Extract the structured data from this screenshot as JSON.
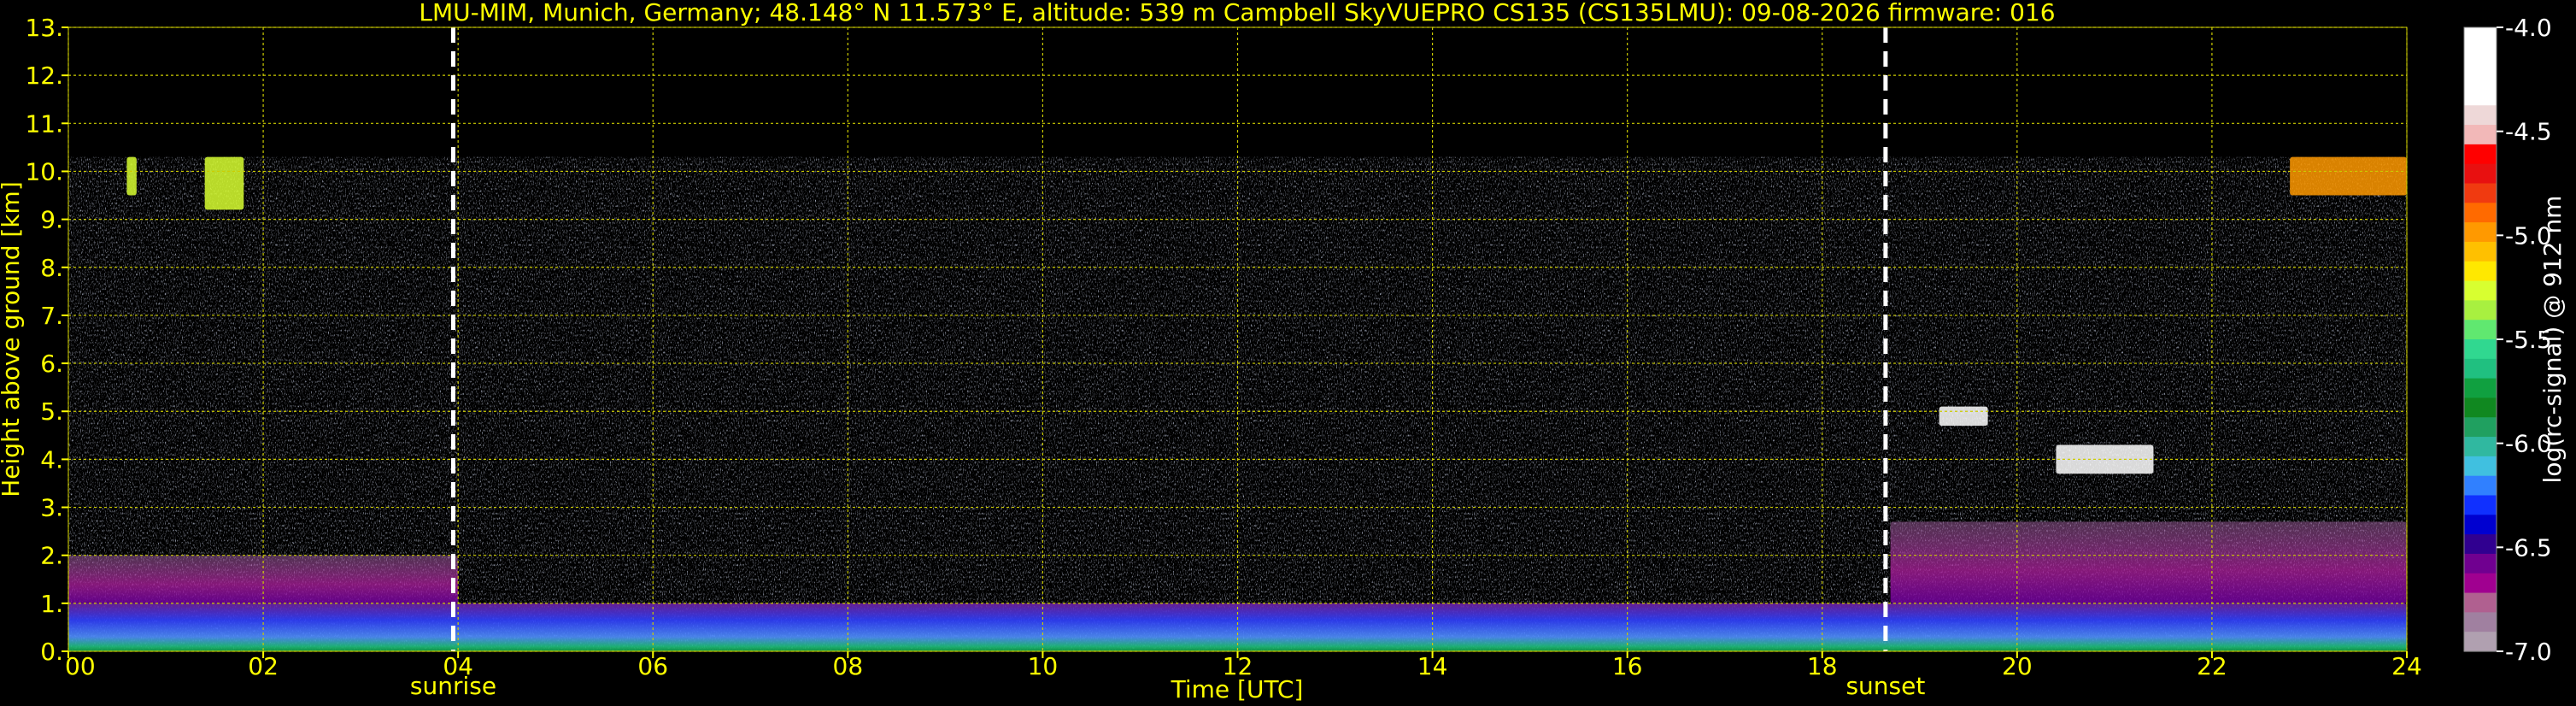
{
  "chart_data": {
    "type": "heatmap",
    "title": "LMU-MIM, Munich, Germany; 48.148° N 11.573° E, altitude: 539 m    Campbell SkyVUEPRO CS135 (CS135LMU): 09-08-2026    firmware: 016",
    "xlabel": "Time [UTC]",
    "ylabel": "Height above ground [km]",
    "xlim": [
      0,
      24
    ],
    "ylim": [
      0,
      13
    ],
    "x_ticks": [
      "00",
      "02",
      "04",
      "06",
      "08",
      "10",
      "12",
      "14",
      "16",
      "18",
      "20",
      "22",
      "24"
    ],
    "y_ticks": [
      "0.",
      "1.",
      "2.",
      "3.",
      "4.",
      "5.",
      "6.",
      "7.",
      "8.",
      "9.",
      "10.",
      "11.",
      "12.",
      "13."
    ],
    "grid": true,
    "markers": [
      {
        "label": "sunrise",
        "x": 3.95
      },
      {
        "label": "sunset",
        "x": 18.65
      }
    ],
    "colorbar": {
      "label": "log(rc-signal) @ 912 nm",
      "range": [
        -7.0,
        -4.0
      ],
      "ticks": [
        "-4.0",
        "-4.5",
        "-5.0",
        "-5.5",
        "-6.0",
        "-6.5",
        "-7.0"
      ],
      "colors": [
        "#ffffff",
        "#ffffff",
        "#ffffff",
        "#ffffff",
        "#eed8d8",
        "#f2b8b8",
        "#ff0000",
        "#e81010",
        "#f03a10",
        "#ff6a00",
        "#ff9900",
        "#ffc000",
        "#ffe800",
        "#d8ff30",
        "#a8f040",
        "#60e870",
        "#30d890",
        "#20c080",
        "#10a040",
        "#108820",
        "#20a060",
        "#30b8a0",
        "#40c0e0",
        "#3080ff",
        "#1030ff",
        "#0000d0",
        "#300090",
        "#700090",
        "#a00090",
        "#b06090",
        "#a080a0",
        "#b0a0b0"
      ],
      "data_max_height_km": 10.3
    },
    "features": [
      {
        "name": "boundary-layer aerosol",
        "x_range": [
          0,
          24
        ],
        "height_km": [
          0,
          1.0
        ],
        "level": -6.6
      },
      {
        "name": "nocturnal residual layer",
        "x_range": [
          0,
          4
        ],
        "height_km": [
          1.0,
          2.0
        ],
        "level": -6.8
      },
      {
        "name": "evening residual layer",
        "x_range": [
          18.7,
          24
        ],
        "height_km": [
          1.0,
          2.7
        ],
        "level": -6.7
      },
      {
        "name": "mid-level cloud",
        "x_range": [
          19.2,
          19.7
        ],
        "height_km": [
          4.7,
          5.1
        ],
        "level": -4.3
      },
      {
        "name": "mid-level cloud",
        "x_range": [
          20.4,
          21.4
        ],
        "height_km": [
          3.7,
          4.3
        ],
        "level": -4.3
      },
      {
        "name": "cirrus",
        "x_range": [
          0.6,
          0.7
        ],
        "height_km": [
          9.5,
          10.3
        ],
        "level": -5.3
      },
      {
        "name": "cirrus",
        "x_range": [
          1.4,
          1.8
        ],
        "height_km": [
          9.2,
          10.3
        ],
        "level": -5.3
      },
      {
        "name": "cirrus",
        "x_range": [
          22.8,
          24
        ],
        "height_km": [
          9.5,
          10.3
        ],
        "level": -5.0
      }
    ]
  }
}
